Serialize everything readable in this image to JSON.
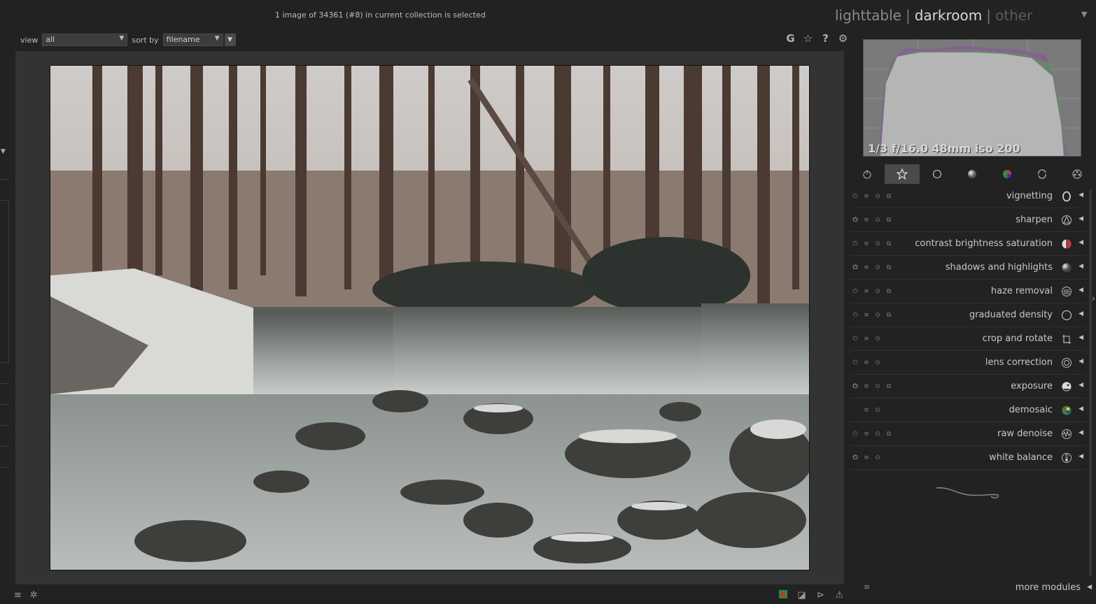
{
  "status": {
    "selection_text": "1 image of 34361 (#8) in current collection is selected"
  },
  "views": {
    "lighttable": "lighttable",
    "separator": "|",
    "darkroom": "darkroom",
    "other": "other"
  },
  "filter": {
    "view_label": "view",
    "view_value": "all",
    "sort_label": "sort by",
    "sort_value": "filename"
  },
  "top_icons": [
    {
      "name": "grouping-icon",
      "glyph": "G"
    },
    {
      "name": "star-overlay-icon",
      "glyph": "☆"
    },
    {
      "name": "help-icon",
      "glyph": "?"
    },
    {
      "name": "preferences-gear-icon",
      "glyph": "⚙"
    }
  ],
  "histogram": {
    "exif_info": "1/3 f/16.0 48mm iso 200"
  },
  "module_groups": [
    {
      "name": "active-modules-group",
      "glyph": "⏻"
    },
    {
      "name": "favorites-group",
      "glyph": "✩",
      "active": true
    },
    {
      "name": "basic-group",
      "glyph": "○"
    },
    {
      "name": "tone-group",
      "glyph": "●"
    },
    {
      "name": "color-group",
      "glyph": "◉"
    },
    {
      "name": "correct-group",
      "glyph": "⟳"
    },
    {
      "name": "effect-group",
      "glyph": "✿"
    }
  ],
  "modules": [
    {
      "name": "vignetting",
      "on": false,
      "presets": true,
      "power": true,
      "icon": "vignetting-icon"
    },
    {
      "name": "sharpen",
      "on": true,
      "presets": true,
      "power": true,
      "icon": "sharpen-icon"
    },
    {
      "name": "contrast brightness saturation",
      "on": false,
      "presets": true,
      "power": true,
      "icon": "contrast-icon"
    },
    {
      "name": "shadows and highlights",
      "on": true,
      "presets": true,
      "power": true,
      "icon": "shadows-highlights-icon"
    },
    {
      "name": "haze removal",
      "on": false,
      "presets": true,
      "power": true,
      "icon": "haze-removal-icon"
    },
    {
      "name": "graduated density",
      "on": false,
      "presets": true,
      "power": true,
      "icon": "graduated-density-icon"
    },
    {
      "name": "crop and rotate",
      "on": false,
      "presets": false,
      "power": true,
      "icon": "crop-icon"
    },
    {
      "name": "lens correction",
      "on": false,
      "presets": false,
      "power": true,
      "icon": "lens-correction-icon"
    },
    {
      "name": "exposure",
      "on": true,
      "presets": true,
      "power": true,
      "icon": "exposure-icon"
    },
    {
      "name": "demosaic",
      "on": true,
      "presets": false,
      "power": false,
      "icon": "demosaic-icon"
    },
    {
      "name": "raw denoise",
      "on": false,
      "presets": true,
      "power": true,
      "icon": "raw-denoise-icon"
    },
    {
      "name": "white balance",
      "on": true,
      "presets": false,
      "power": true,
      "icon": "white-balance-icon"
    }
  ],
  "footer": {
    "more_modules": "more modules"
  },
  "bottom_icons": {
    "left": [
      "panel-menu-icon",
      "quick-access-icon"
    ],
    "right": [
      "color-assessment-icon",
      "overexposed-icon",
      "softproof-icon",
      "gamut-check-icon"
    ]
  }
}
